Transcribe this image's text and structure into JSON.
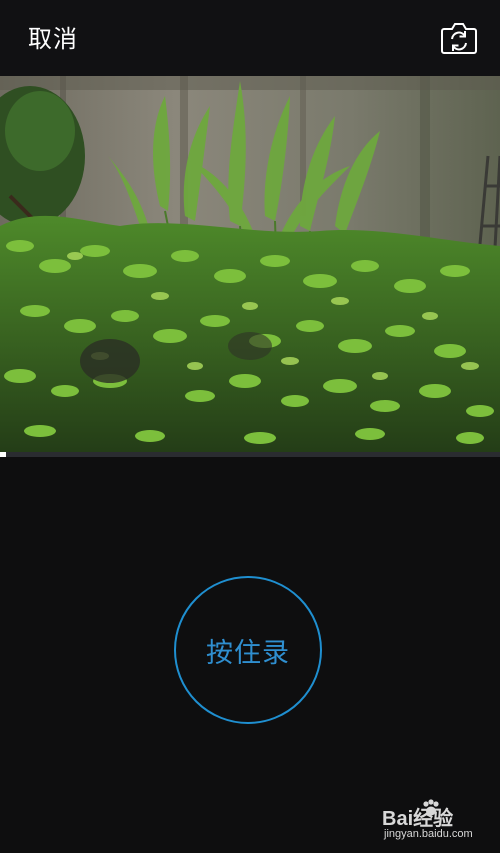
{
  "topbar": {
    "cancel_label": "取消",
    "flip_icon": "switch-camera-icon"
  },
  "recording": {
    "progress": 0.012,
    "button_label": "按住录",
    "accent_color": "#1f8fd0"
  },
  "watermark": {
    "brand": "Bai经验",
    "url": "jingyan.baidu.com"
  }
}
